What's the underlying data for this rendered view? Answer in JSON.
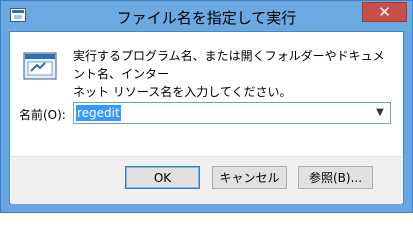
{
  "window": {
    "title": "ファイル名を指定して実行",
    "close_symbol": "✕"
  },
  "icons": {
    "app": "run-dialog-icon",
    "run": "run-window-icon",
    "close": "close-icon",
    "dropdown": "chevron-down-icon"
  },
  "dialog": {
    "description_line1": "実行するプログラム名、または開くフォルダーやドキュメント名、インター",
    "description_line2": "ネット リソース名を入力してください。",
    "open_label": "名前(O):",
    "open_value": "regedit"
  },
  "buttons": {
    "ok": "OK",
    "cancel": "キャンセル",
    "browse": "参照(B)..."
  },
  "colors": {
    "titlebar": "#6aa9e2",
    "close": "#c7504b",
    "selection": "#3399ff"
  }
}
